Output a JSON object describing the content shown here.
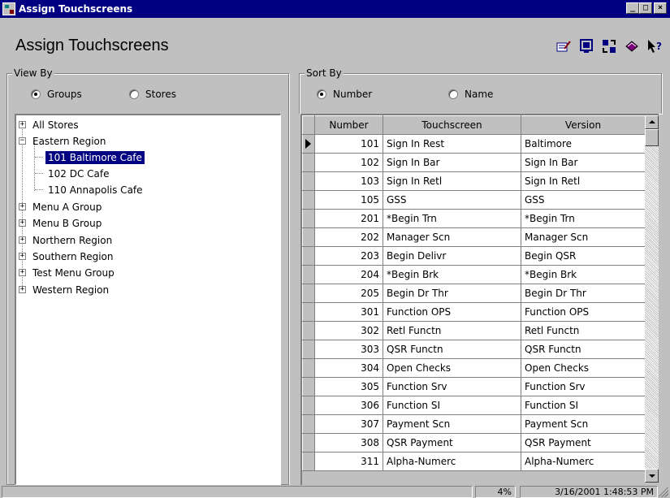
{
  "window": {
    "title": "Assign Touchscreens",
    "controls": {
      "minimize": "_",
      "maximize": "□",
      "close": "×"
    }
  },
  "header": {
    "title": "Assign Touchscreens",
    "tool_icons": [
      "edit-form-icon",
      "screen-icon",
      "transfer-icon",
      "book-icon",
      "help-pointer-icon"
    ]
  },
  "view_by": {
    "legend": "View By",
    "options": [
      {
        "label": "Groups",
        "checked": true
      },
      {
        "label": "Stores",
        "checked": false
      }
    ]
  },
  "sort_by": {
    "legend": "Sort By",
    "options": [
      {
        "label": "Number",
        "checked": true
      },
      {
        "label": "Name",
        "checked": false
      }
    ]
  },
  "tree": {
    "nodes": [
      {
        "label": "All Stores",
        "expander": "+"
      },
      {
        "label": "Eastern Region",
        "expander": "−"
      },
      {
        "label": "101  Baltimore Cafe",
        "selected": true
      },
      {
        "label": "102  DC Cafe"
      },
      {
        "label": "110  Annapolis Cafe"
      },
      {
        "label": "Menu A Group",
        "expander": "+"
      },
      {
        "label": "Menu B Group",
        "expander": "+"
      },
      {
        "label": "Northern Region",
        "expander": "+"
      },
      {
        "label": "Southern Region",
        "expander": "+"
      },
      {
        "label": "Test Menu Group",
        "expander": "+"
      },
      {
        "label": "Western Region",
        "expander": "+"
      }
    ]
  },
  "grid": {
    "columns": [
      "Number",
      "Touchscreen",
      "Version"
    ],
    "rows": [
      [
        "101",
        "Sign In Rest",
        "Baltimore"
      ],
      [
        "102",
        "Sign In Bar",
        "Sign In Bar"
      ],
      [
        "103",
        "Sign In Retl",
        "Sign In Retl"
      ],
      [
        "105",
        "GSS",
        "GSS"
      ],
      [
        "201",
        "*Begin Trn",
        "*Begin Trn"
      ],
      [
        "202",
        "Manager Scn",
        "Manager Scn"
      ],
      [
        "203",
        "Begin Delivr",
        "Begin QSR"
      ],
      [
        "204",
        "*Begin Brk",
        "*Begin Brk"
      ],
      [
        "205",
        "Begin Dr Thr",
        "Begin Dr Thr"
      ],
      [
        "301",
        "Function OPS",
        "Function OPS"
      ],
      [
        "302",
        "Retl Functn",
        "Retl Functn"
      ],
      [
        "303",
        "QSR Functn",
        "QSR Functn"
      ],
      [
        "304",
        "Open Checks",
        "Open Checks"
      ],
      [
        "305",
        "Function Srv",
        "Function Srv"
      ],
      [
        "306",
        "Function SI",
        "Function SI"
      ],
      [
        "307",
        "Payment Scn",
        "Payment Scn"
      ],
      [
        "308",
        "QSR Payment",
        "QSR Payment"
      ],
      [
        "311",
        "Alpha-Numerc",
        "Alpha-Numerc"
      ]
    ]
  },
  "statusbar": {
    "percent": "4%",
    "datetime": "3/16/2001 1:48:53 PM"
  }
}
